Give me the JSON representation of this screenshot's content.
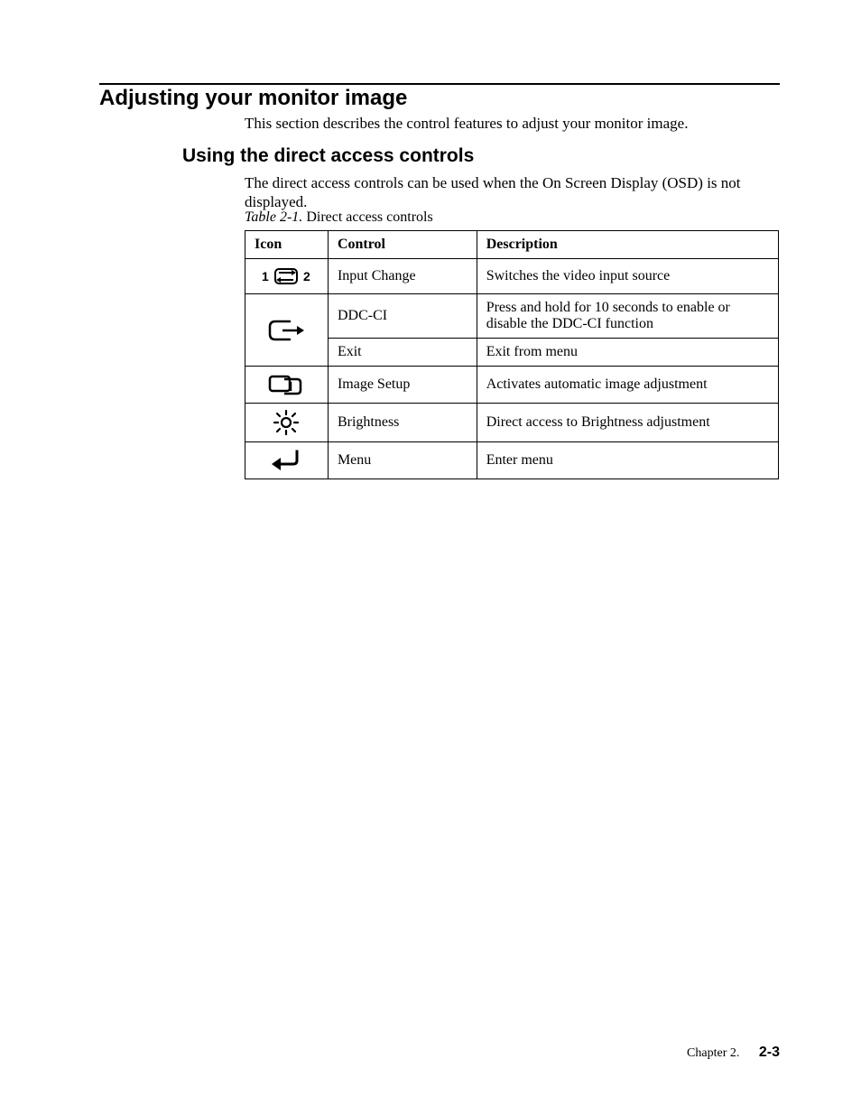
{
  "h1": "Adjusting your monitor image",
  "intro": "This section describes the control features to adjust your monitor image.",
  "h2": "Using the direct access controls",
  "p1": "The direct access controls can be used when the On Screen Display (OSD) is not displayed.",
  "table_caption_it": "Table 2-1.",
  "table_caption_rest": " Direct access controls",
  "thead": {
    "icon": "Icon",
    "control": "Control",
    "description": "Description"
  },
  "rows": [
    {
      "control": "Input Change",
      "description": "Switches the video input source"
    },
    {
      "control": "DDC-CI",
      "description": "Press and hold for 10 seconds to enable or disable the DDC-CI function"
    },
    {
      "control": "Exit",
      "description": "Exit from menu"
    },
    {
      "control": "Image Setup",
      "description": "Activates automatic image adjustment"
    },
    {
      "control": "Brightness",
      "description": "Direct access to Brightness adjustment"
    },
    {
      "control": "Menu",
      "description": "Enter menu"
    }
  ],
  "footer_chapter": "Chapter 2.",
  "footer_page": "2-3"
}
